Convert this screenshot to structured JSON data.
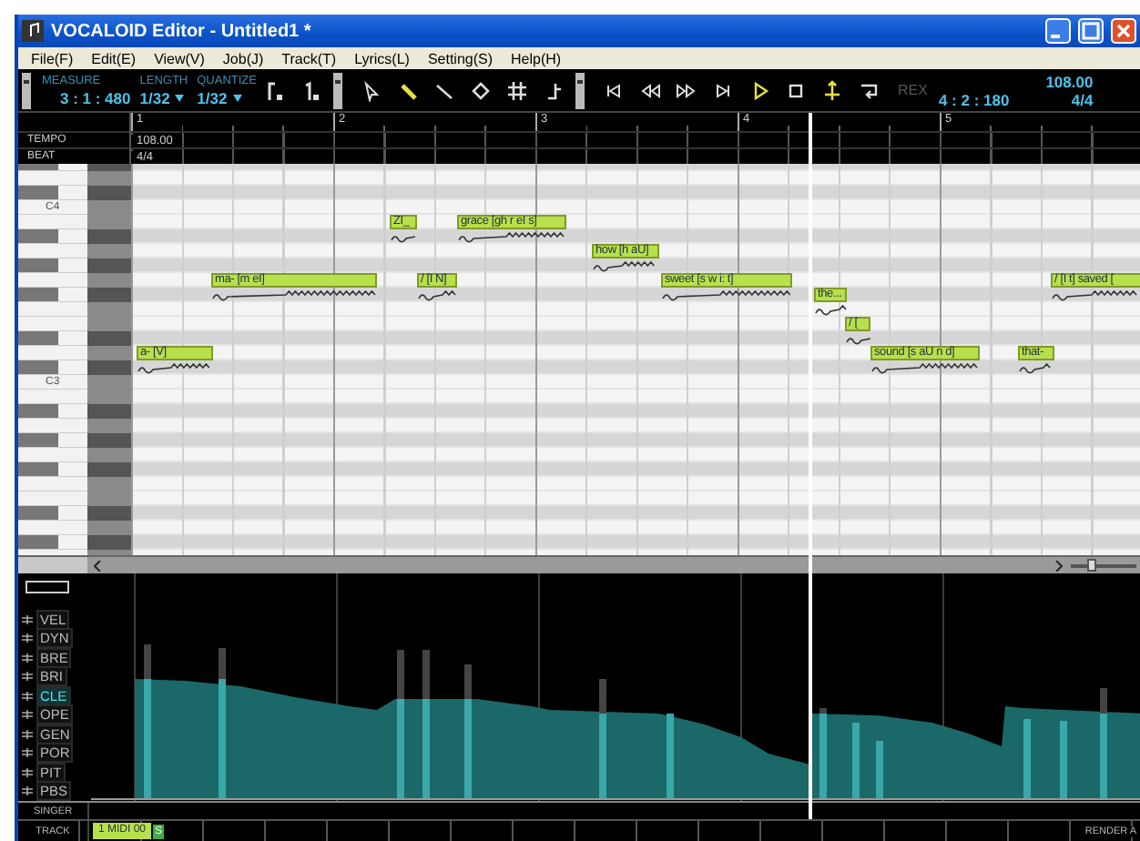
{
  "window": {
    "title": "VOCALOID Editor - Untitled1 *"
  },
  "menu": [
    "File(F)",
    "Edit(E)",
    "View(V)",
    "Job(J)",
    "Track(T)",
    "Lyrics(L)",
    "Setting(S)",
    "Help(H)"
  ],
  "toolbar": {
    "measure_label": "MEASURE",
    "length_label": "LENGTH",
    "quantize_label": "QUANTIZE",
    "measure": "3 : 1 : 480",
    "length": "1/32",
    "quantize": "1/32",
    "snap_tools": [
      {
        "kind": "snap"
      },
      {
        "kind": "length"
      }
    ],
    "tools": [
      {
        "kind": "select",
        "selected": false
      },
      {
        "kind": "pencil",
        "selected": true
      },
      {
        "kind": "line",
        "selected": false
      },
      {
        "kind": "eraser",
        "selected": false
      },
      {
        "kind": "grid",
        "selected": false
      },
      {
        "kind": "curve",
        "selected": false
      }
    ],
    "transport": [
      {
        "kind": "start",
        "on": false
      },
      {
        "kind": "rewind",
        "on": false
      },
      {
        "kind": "forward",
        "on": false
      },
      {
        "kind": "end",
        "on": false
      },
      {
        "kind": "play",
        "on": true
      },
      {
        "kind": "stop",
        "on": false
      },
      {
        "kind": "autoscroll",
        "on": true
      },
      {
        "kind": "loop",
        "on": false
      }
    ],
    "rex": {
      "label": "REX",
      "disabled": true
    },
    "position": "4 : 2 : 180",
    "tempo": "108.00",
    "beat": "4/4"
  },
  "ruler": {
    "measures": [
      "1",
      "2",
      "3",
      "4",
      "5"
    ],
    "tempo_label": "TEMPO",
    "tempo": "108.00",
    "beat_label": "BEAT",
    "beat": "4/4"
  },
  "piano": {
    "labels": [
      "C4",
      "C3"
    ]
  },
  "notes": [
    {
      "lyric": "a- [V]"
    },
    {
      "lyric": "ma- [m eI]"
    },
    {
      "lyric": "ZI_"
    },
    {
      "lyric": "/ [I N]"
    },
    {
      "lyric": "grace [gh r eI s]"
    },
    {
      "lyric": "how [h aU]"
    },
    {
      "lyric": "sweet [s w i: t]"
    },
    {
      "lyric": "the..."
    },
    {
      "lyric": "/ ["
    },
    {
      "lyric": "sound [s aU n d]"
    },
    {
      "lyric": "that-"
    },
    {
      "lyric": "/ [I t] saved ["
    }
  ],
  "zoom": {
    "level": 0.25
  },
  "params": [
    {
      "label": "VEL",
      "selected": false
    },
    {
      "label": "DYN",
      "selected": false
    },
    {
      "label": "BRE",
      "selected": false
    },
    {
      "label": "BRI",
      "selected": false
    },
    {
      "label": "CLE",
      "selected": true
    },
    {
      "label": "OPE",
      "selected": false
    },
    {
      "label": "GEN",
      "selected": false
    },
    {
      "label": "POR",
      "selected": false
    },
    {
      "label": "PIT",
      "selected": false
    },
    {
      "label": "PBS",
      "selected": false
    }
  ],
  "singer_label": "SINGER",
  "track_label": "TRACK",
  "tracks": [
    {
      "label": "1 MIDI 00",
      "solo": "S",
      "selected": true
    }
  ],
  "render": "RENDER A"
}
